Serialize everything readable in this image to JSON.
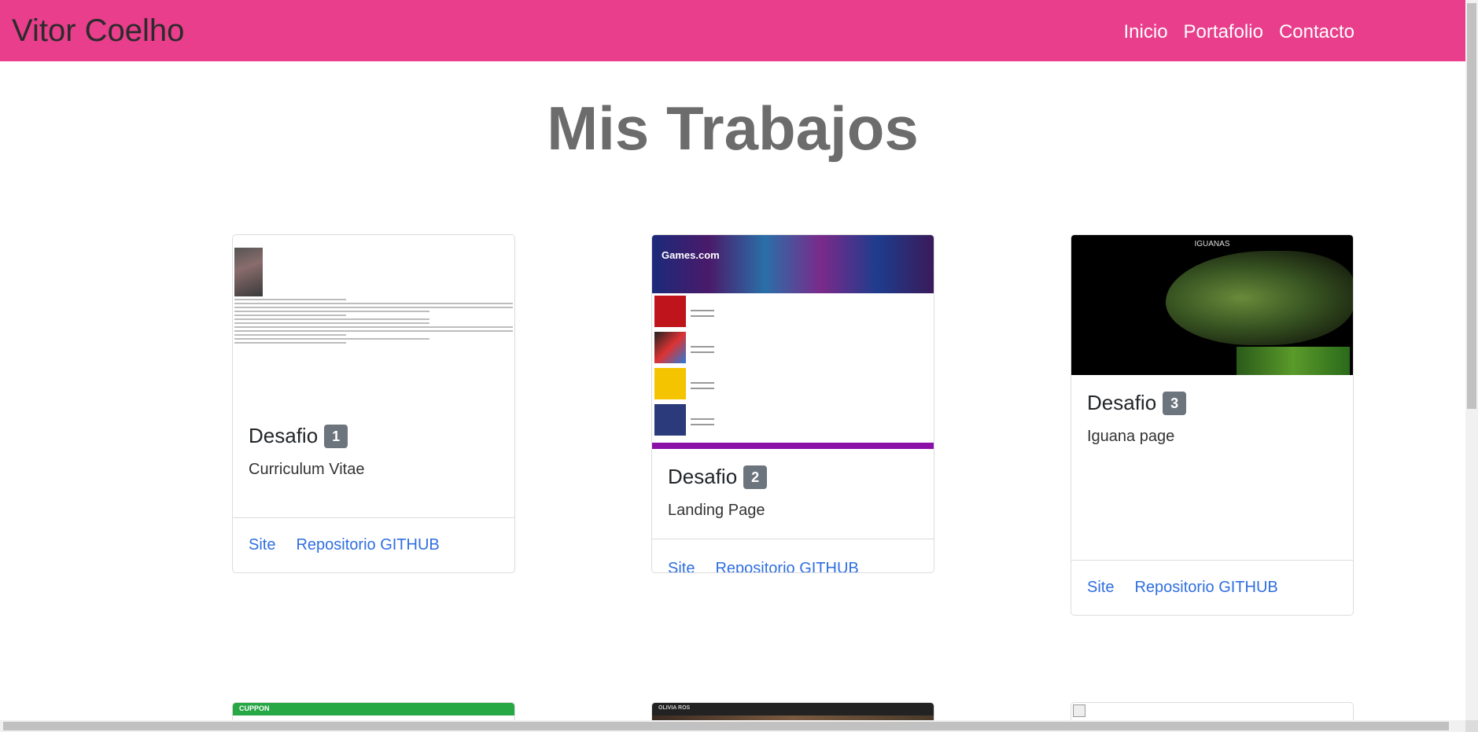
{
  "navbar": {
    "brand": "Vitor Coelho",
    "links": [
      "Inicio",
      "Portafolio",
      "Contacto"
    ]
  },
  "page": {
    "title": "Mis Trabajos"
  },
  "cards": [
    {
      "title": "Desafio",
      "badge": "1",
      "text": "Curriculum Vitae",
      "site_label": "Site",
      "repo_label": "Repositorio GITHUB"
    },
    {
      "title": "Desafio",
      "badge": "2",
      "text": "Landing Page",
      "site_label": "Site",
      "repo_label": "Repositorio GITHUB",
      "preview_heading": "Games.com"
    },
    {
      "title": "Desafio",
      "badge": "3",
      "text": "Iguana page",
      "site_label": "Site",
      "repo_label": "Repositorio GITHUB",
      "preview_heading": "IGUANAS"
    }
  ],
  "bottom_cards": [
    {
      "preview_heading": "CUPPON"
    },
    {
      "preview_heading": "OLIVIA ROS"
    },
    {
      "preview_heading": ""
    }
  ],
  "colors": {
    "navbar": "#e83e8c",
    "link": "#2f6fdf",
    "badge": "#6c757d",
    "title": "#6c6c6c"
  }
}
